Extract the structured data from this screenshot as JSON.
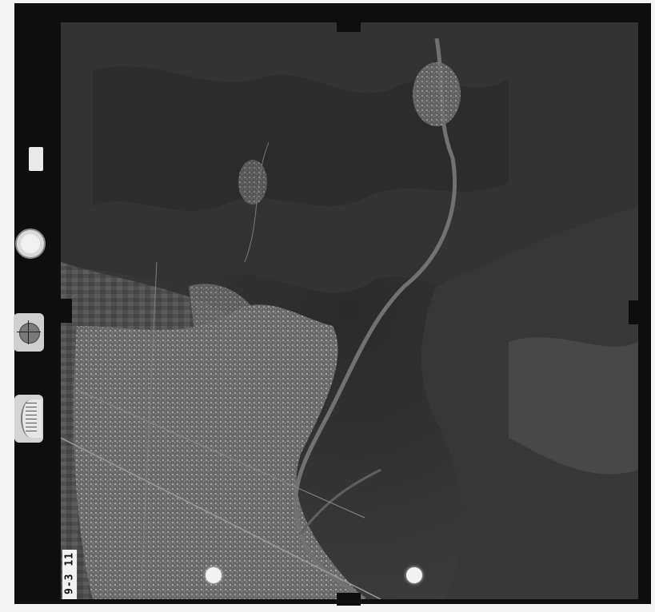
{
  "frame_number": "9-3 11",
  "colors": {
    "border": "#0e0e0e",
    "terrain_dark": "#2c2c2c",
    "terrain_mid": "#4a4a4a",
    "urban_light": "#8c8c8c",
    "river": "#6e6e6e"
  },
  "instruments": {
    "clock_icon": "clock-icon",
    "level_icon": "bubble-level-icon",
    "altimeter_icon": "altimeter-icon"
  }
}
